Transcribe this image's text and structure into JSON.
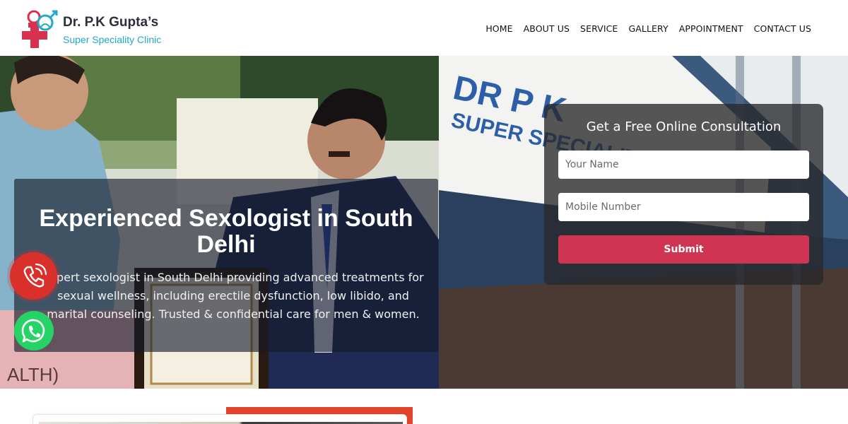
{
  "brand": {
    "name": "Dr. P.K Gupta’s",
    "tagline": "Super Speciality Clinic",
    "colors": {
      "cross": "#d8314f",
      "accent": "#22a8c9"
    }
  },
  "nav": {
    "items": [
      {
        "label": "HOME"
      },
      {
        "label": "ABOUT US"
      },
      {
        "label": "SERVICE"
      },
      {
        "label": "GALLERY"
      },
      {
        "label": "APPOINTMENT"
      },
      {
        "label": "CONTACT US"
      }
    ]
  },
  "hero": {
    "title": "Experienced Sexologist in South Delhi",
    "description": "Expert sexologist in South Delhi providing advanced treatments for sexual wellness, including erectile dysfunction, low libido, and marital counseling. Trusted & confidential care for men & women."
  },
  "consultation_form": {
    "title": "Get a Free Online Consultation",
    "name_placeholder": "Your Name",
    "name_value": "",
    "mobile_placeholder": "Mobile Number",
    "mobile_value": "",
    "submit_label": "Submit",
    "submit_color": "#cf3452"
  },
  "floating": {
    "call_icon": "phone-icon",
    "call_color": "#d9302c",
    "whatsapp_icon": "whatsapp-icon",
    "whatsapp_color": "#25d366"
  }
}
